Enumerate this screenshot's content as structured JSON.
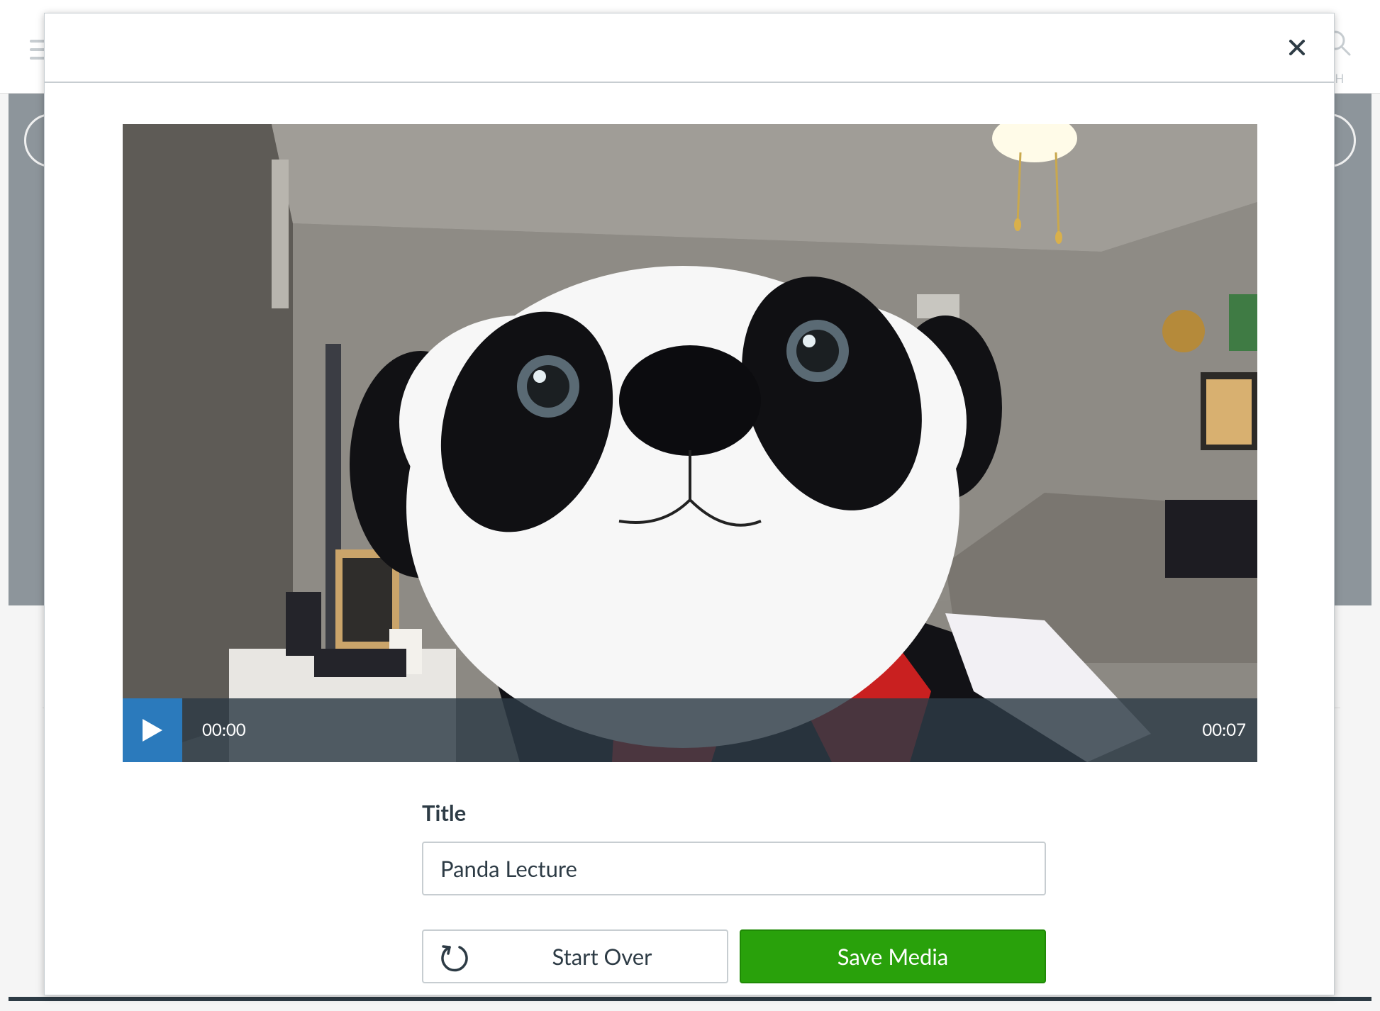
{
  "background": {
    "search_label": "CH"
  },
  "modal": {
    "close_icon": "close-icon"
  },
  "video": {
    "current_time": "00:00",
    "total_time": "00:07",
    "play_icon": "play-icon",
    "colors": {
      "control_bar": "#2d3b45",
      "play_button": "#2b7abc"
    }
  },
  "form": {
    "title_label": "Title",
    "title_value": "Panda Lecture",
    "start_over_label": "Start Over",
    "save_label": "Save Media",
    "colors": {
      "save_button": "#29a10b"
    }
  }
}
